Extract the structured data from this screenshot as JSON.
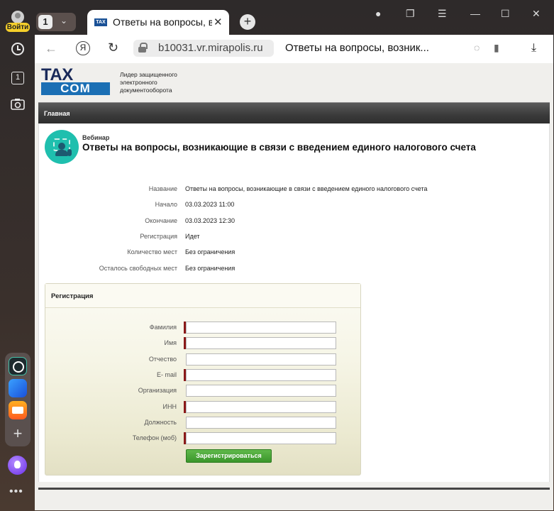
{
  "sidebar": {
    "login_label": "Войти",
    "tab_number": "1",
    "icons": [
      "clock-icon",
      "tab-icon",
      "screenshot-icon"
    ],
    "apps": [
      "alice-app-icon",
      "mail-app-icon",
      "messenger-app-icon"
    ],
    "add_label": "+",
    "more_label": "•••"
  },
  "tabbar": {
    "tab_count": "1",
    "active_tab_title": "Ответы на вопросы, во",
    "favicon_text": "TAX",
    "close": "✕",
    "new_tab": "+"
  },
  "address_bar": {
    "ya_label": "Я",
    "url": "b10031.vr.mirapolis.ru",
    "page_title": "Ответы на вопросы, возник..."
  },
  "page": {
    "logo_top": "TAX",
    "logo_bottom": "COM",
    "tagline": "Лидер защищенного электронного документооборота",
    "nav_home": "Главная",
    "event_type": "Вебинар",
    "event_title": "Ответы на вопросы, возникающие в связи с введением единого налогового счета",
    "info": [
      {
        "label": "Название",
        "value": "Ответы на вопросы, возникающие в связи с введением единого налогового счета"
      },
      {
        "label": "Начало",
        "value": "03.03.2023 11:00"
      },
      {
        "label": "Окончание",
        "value": "03.03.2023 12:30"
      },
      {
        "label": "Регистрация",
        "value": "Идет"
      },
      {
        "label": "Количество мест",
        "value": "Без ограничения"
      },
      {
        "label": "Осталось свободных мест",
        "value": "Без ограничения"
      }
    ],
    "registration": {
      "title": "Регистрация",
      "fields": [
        {
          "label": "Фамилия",
          "required": true,
          "value": ""
        },
        {
          "label": "Имя",
          "required": true,
          "value": ""
        },
        {
          "label": "Отчество",
          "required": false,
          "value": ""
        },
        {
          "label": "E- mail",
          "required": true,
          "value": ""
        },
        {
          "label": "Организация",
          "required": false,
          "value": ""
        },
        {
          "label": "ИНН",
          "required": true,
          "value": ""
        },
        {
          "label": "Должность",
          "required": false,
          "value": ""
        },
        {
          "label": "Телефон (моб)",
          "required": true,
          "value": ""
        }
      ],
      "submit_label": "Зарегистрироваться"
    }
  },
  "colors": {
    "accent_green": "#3a962b",
    "required_marker": "#8b1a1a",
    "logo_blue": "#1b6fb4",
    "webinar_icon": "#1fbfae"
  }
}
